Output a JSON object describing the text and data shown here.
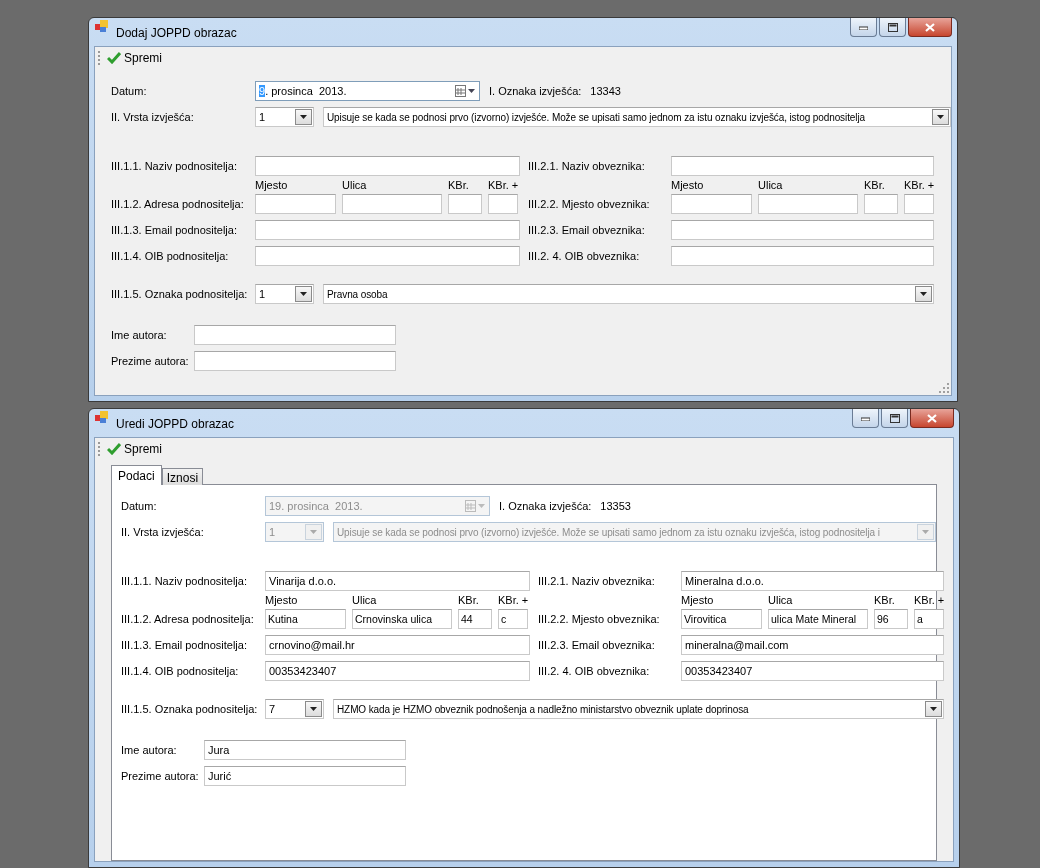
{
  "windows": [
    {
      "title": "Dodaj JOPPD obrazac",
      "save_label": "Spremi",
      "resizable": true,
      "form": {
        "date": {
          "label": "Datum:",
          "disabled": false,
          "parts": [
            {
              "text": "9",
              "selected": true
            },
            {
              "text": ". prosinca  2013.",
              "selected": false
            }
          ]
        },
        "report_mark": {
          "label": "I. Oznaka izvješća:",
          "value": "13343"
        },
        "report_type": {
          "label": "II. Vrsta izvješća:",
          "code": "1",
          "description": "Upisuje se kada se podnosi prvo (izvorno) izvješće. Može se upisati samo jednom za istu oznaku izvješća, istog podnositelja",
          "disabled": false
        },
        "submitter": [
          {
            "kind": "text",
            "label": "III.1.1. Naziv podnositelja:"
          },
          {
            "kind": "address",
            "label": "III.1.2. Adresa podnositelja:",
            "headers": [
              "Mjesto",
              "Ulica",
              "KBr.",
              "KBr. +"
            ]
          },
          {
            "kind": "text",
            "label": "III.1.3. Email podnositelja:"
          },
          {
            "kind": "text",
            "label": "III.1.4. OIB podnositelja:"
          }
        ],
        "payer": [
          {
            "kind": "text",
            "label": "III.2.1. Naziv obveznika:"
          },
          {
            "kind": "address",
            "label": "III.2.2. Mjesto obveznika:",
            "headers": [
              "Mjesto",
              "Ulica",
              "KBr.",
              "KBr. +"
            ]
          },
          {
            "kind": "text",
            "label": "III.2.3. Email obveznika:"
          },
          {
            "kind": "text",
            "label": "III.2. 4. OIB obveznika:"
          }
        ],
        "submitter_mark": {
          "label": "III.1.5. Oznaka podnositelja:",
          "code": "1",
          "description": "Pravna osoba",
          "disabled": false
        },
        "author": [
          {
            "label": "Ime autora:"
          },
          {
            "label": "Prezime autora:"
          }
        ]
      }
    },
    {
      "title": "Uredi JOPPD obrazac",
      "save_label": "Spremi",
      "resizable": false,
      "tabs": [
        {
          "label": "Podaci",
          "selected": true
        },
        {
          "label": "Iznosi",
          "selected": false
        }
      ],
      "form": {
        "date": {
          "label": "Datum:",
          "disabled": true,
          "parts": [
            {
              "text": "19. prosinca  2013.",
              "selected": false
            }
          ]
        },
        "report_mark": {
          "label": "I. Oznaka izvješća:",
          "value": "13353"
        },
        "report_type": {
          "label": "II. Vrsta izvješća:",
          "code": "1",
          "description": "Upisuje se kada se podnosi prvo (izvorno) izvješće. Može se upisati samo jednom za istu oznaku izvješća, istog podnositelja i",
          "disabled": true
        },
        "submitter": [
          {
            "kind": "text",
            "label": "III.1.1. Naziv podnositelja:",
            "value": "Vinarija d.o.o."
          },
          {
            "kind": "address",
            "label": "III.1.2. Adresa podnositelja:",
            "headers": [
              "Mjesto",
              "Ulica",
              "KBr.",
              "KBr. +"
            ],
            "values": [
              "Kutina",
              "Crnovinska ulica",
              "44",
              "c"
            ]
          },
          {
            "kind": "text",
            "label": "III.1.3. Email podnositelja:",
            "value": "crnovino@mail.hr"
          },
          {
            "kind": "text",
            "label": "III.1.4. OIB podnositelja:",
            "value": "00353423407"
          }
        ],
        "payer": [
          {
            "kind": "text",
            "label": "III.2.1. Naziv obveznika:",
            "value": "Mineralna d.o.o."
          },
          {
            "kind": "address",
            "label": "III.2.2. Mjesto obveznika:",
            "headers": [
              "Mjesto",
              "Ulica",
              "KBr.",
              "KBr. +"
            ],
            "values": [
              "Virovitica",
              "ulica Mate Mineral",
              "96",
              "a"
            ]
          },
          {
            "kind": "text",
            "label": "III.2.3. Email obveznika:",
            "value": "mineralna@mail.com"
          },
          {
            "kind": "text",
            "label": "III.2. 4. OIB obveznika:",
            "value": "00353423407"
          }
        ],
        "submitter_mark": {
          "label": "III.1.5. Oznaka podnositelja:",
          "code": "7",
          "description": "HZMO kada je HZMO obveznik podnošenja a nadležno ministarstvo obveznik uplate doprinosa",
          "disabled": false
        },
        "author": [
          {
            "label": "Ime autora:",
            "value": "Jura"
          },
          {
            "label": "Prezime autora:",
            "value": "Jurić"
          }
        ]
      }
    }
  ]
}
